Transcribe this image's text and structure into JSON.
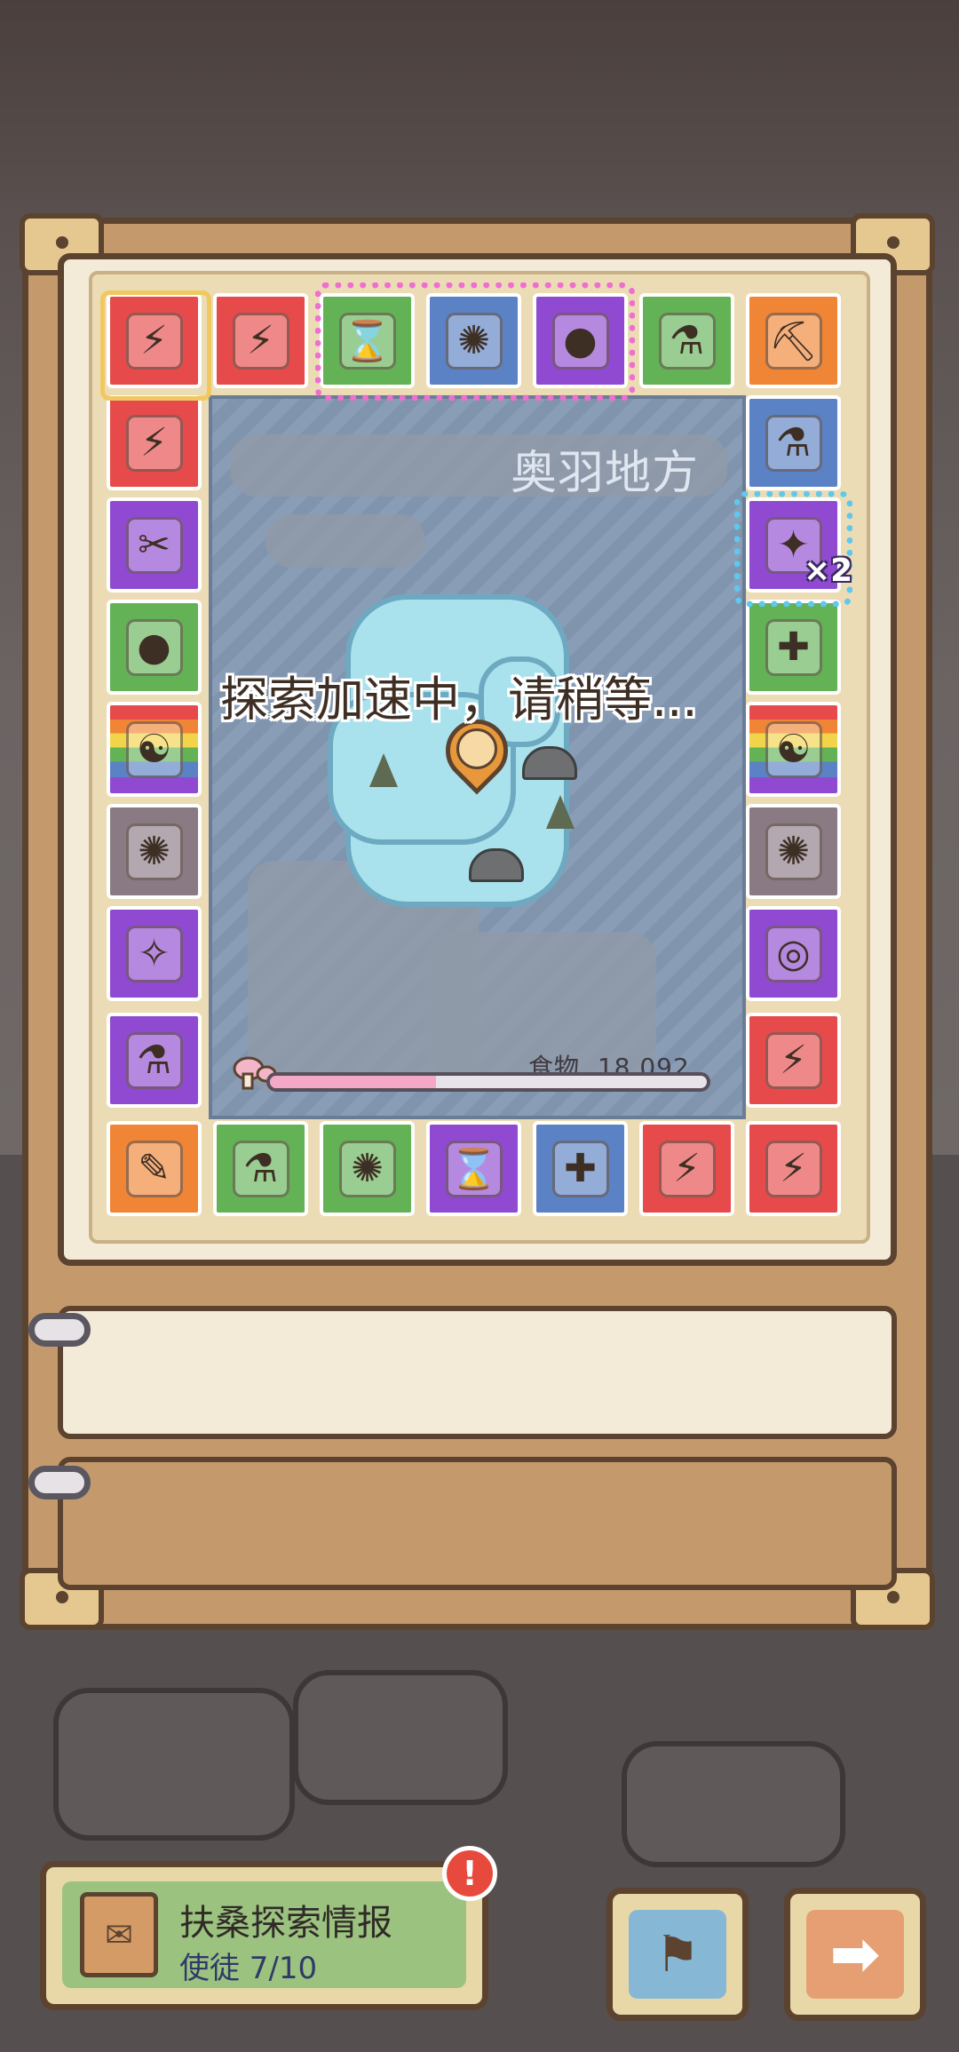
{
  "map": {
    "region_name": "奥羽地方",
    "status_text": "探索加速中，请稍等..."
  },
  "resource": {
    "label": "食物",
    "value": "18,092",
    "fill_fraction": 0.38
  },
  "board_tiles": [
    {
      "id": "top-1",
      "item": "battery",
      "icon": "⚡",
      "color": "red"
    },
    {
      "id": "top-2",
      "item": "battery",
      "icon": "⚡",
      "color": "red"
    },
    {
      "id": "top-3",
      "item": "hourglass",
      "icon": "⌛",
      "color": "green"
    },
    {
      "id": "top-4",
      "item": "gear-orb",
      "icon": "✺",
      "color": "blue"
    },
    {
      "id": "top-5",
      "item": "stone",
      "icon": "●",
      "color": "purple"
    },
    {
      "id": "top-6",
      "item": "potion",
      "icon": "⚗",
      "color": "green"
    },
    {
      "id": "top-7",
      "item": "pickaxe",
      "icon": "⛏",
      "color": "orange"
    },
    {
      "id": "right-1",
      "item": "potion",
      "icon": "⚗",
      "color": "blue"
    },
    {
      "id": "right-2",
      "item": "rune",
      "icon": "✦",
      "color": "purple"
    },
    {
      "id": "right-3",
      "item": "meat",
      "icon": "✚",
      "color": "green"
    },
    {
      "id": "right-4",
      "item": "card",
      "icon": "☯",
      "color": "rainbow"
    },
    {
      "id": "right-5",
      "item": "gear-orb",
      "icon": "✺",
      "color": "gray"
    },
    {
      "id": "right-6",
      "item": "ring",
      "icon": "◎",
      "color": "purple"
    },
    {
      "id": "right-7",
      "item": "battery",
      "icon": "⚡",
      "color": "red"
    },
    {
      "id": "bottom-1",
      "item": "scroll",
      "icon": "✎",
      "color": "orange"
    },
    {
      "id": "bottom-2",
      "item": "potion",
      "icon": "⚗",
      "color": "green"
    },
    {
      "id": "bottom-3",
      "item": "gear-orb",
      "icon": "✺",
      "color": "green"
    },
    {
      "id": "bottom-4",
      "item": "hourglass",
      "icon": "⌛",
      "color": "purple"
    },
    {
      "id": "bottom-5",
      "item": "meat",
      "icon": "✚",
      "color": "blue"
    },
    {
      "id": "bottom-6",
      "item": "battery",
      "icon": "⚡",
      "color": "red"
    },
    {
      "id": "bottom-7",
      "item": "battery",
      "icon": "⚡",
      "color": "red"
    },
    {
      "id": "left-1",
      "item": "battery",
      "icon": "⚡",
      "color": "red"
    },
    {
      "id": "left-2",
      "item": "axe",
      "icon": "✂",
      "color": "purple"
    },
    {
      "id": "left-3",
      "item": "stone",
      "icon": "●",
      "color": "green"
    },
    {
      "id": "left-4",
      "item": "card",
      "icon": "☯",
      "color": "rainbow"
    },
    {
      "id": "left-5",
      "item": "gear-orb",
      "icon": "✺",
      "color": "gray"
    },
    {
      "id": "left-6",
      "item": "bone",
      "icon": "✧",
      "color": "purple"
    },
    {
      "id": "left-7",
      "item": "potion",
      "icon": "⚗",
      "color": "purple"
    }
  ],
  "multiplier_badge": "×2",
  "report": {
    "title": "扶桑探索情报",
    "subtitle": "使徒 7/10",
    "alert": "!"
  },
  "buttons": {
    "map_icon": "⚑",
    "next_icon": "➡"
  }
}
